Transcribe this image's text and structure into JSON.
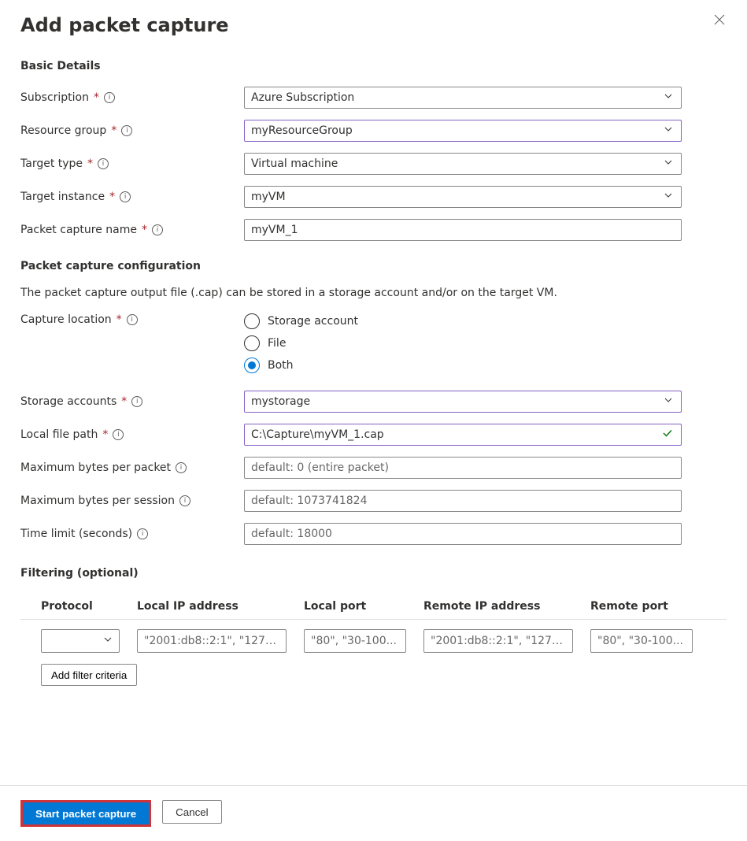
{
  "title": "Add packet capture",
  "sections": {
    "basic": "Basic Details",
    "config": "Packet capture configuration",
    "filter": "Filtering (optional)"
  },
  "labels": {
    "subscription": "Subscription",
    "resourceGroup": "Resource group",
    "targetType": "Target type",
    "targetInstance": "Target instance",
    "captureName": "Packet capture name",
    "captureLocation": "Capture location",
    "storageAccounts": "Storage accounts",
    "localFilePath": "Local file path",
    "maxBytesPacket": "Maximum bytes per packet",
    "maxBytesSession": "Maximum bytes per session",
    "timeLimit": "Time limit (seconds)"
  },
  "values": {
    "subscription": "Azure Subscription",
    "resourceGroup": "myResourceGroup",
    "targetType": "Virtual machine",
    "targetInstance": "myVM",
    "captureName": "myVM_1",
    "storageAccounts": "mystorage",
    "localFilePath": "C:\\Capture\\myVM_1.cap"
  },
  "placeholders": {
    "maxBytesPacket": "default: 0 (entire packet)",
    "maxBytesSession": "default: 1073741824",
    "timeLimit": "default: 18000"
  },
  "helper": "The packet capture output file (.cap) can be stored in a storage account and/or on the target VM.",
  "captureLocationOptions": {
    "storage": "Storage account",
    "file": "File",
    "both": "Both"
  },
  "captureLocationSelected": "both",
  "filterHeaders": {
    "protocol": "Protocol",
    "localIp": "Local IP address",
    "localPort": "Local port",
    "remoteIp": "Remote IP address",
    "remotePort": "Remote port"
  },
  "filterPlaceholders": {
    "localIp": "\"2001:db8::2:1\", \"127.0.0....",
    "localPort": "\"80\", \"30-100...",
    "remoteIp": "\"2001:db8::2:1\", \"127.0.0....",
    "remotePort": "\"80\", \"30-100..."
  },
  "buttons": {
    "addFilter": "Add filter criteria",
    "start": "Start packet capture",
    "cancel": "Cancel"
  },
  "required": "*"
}
